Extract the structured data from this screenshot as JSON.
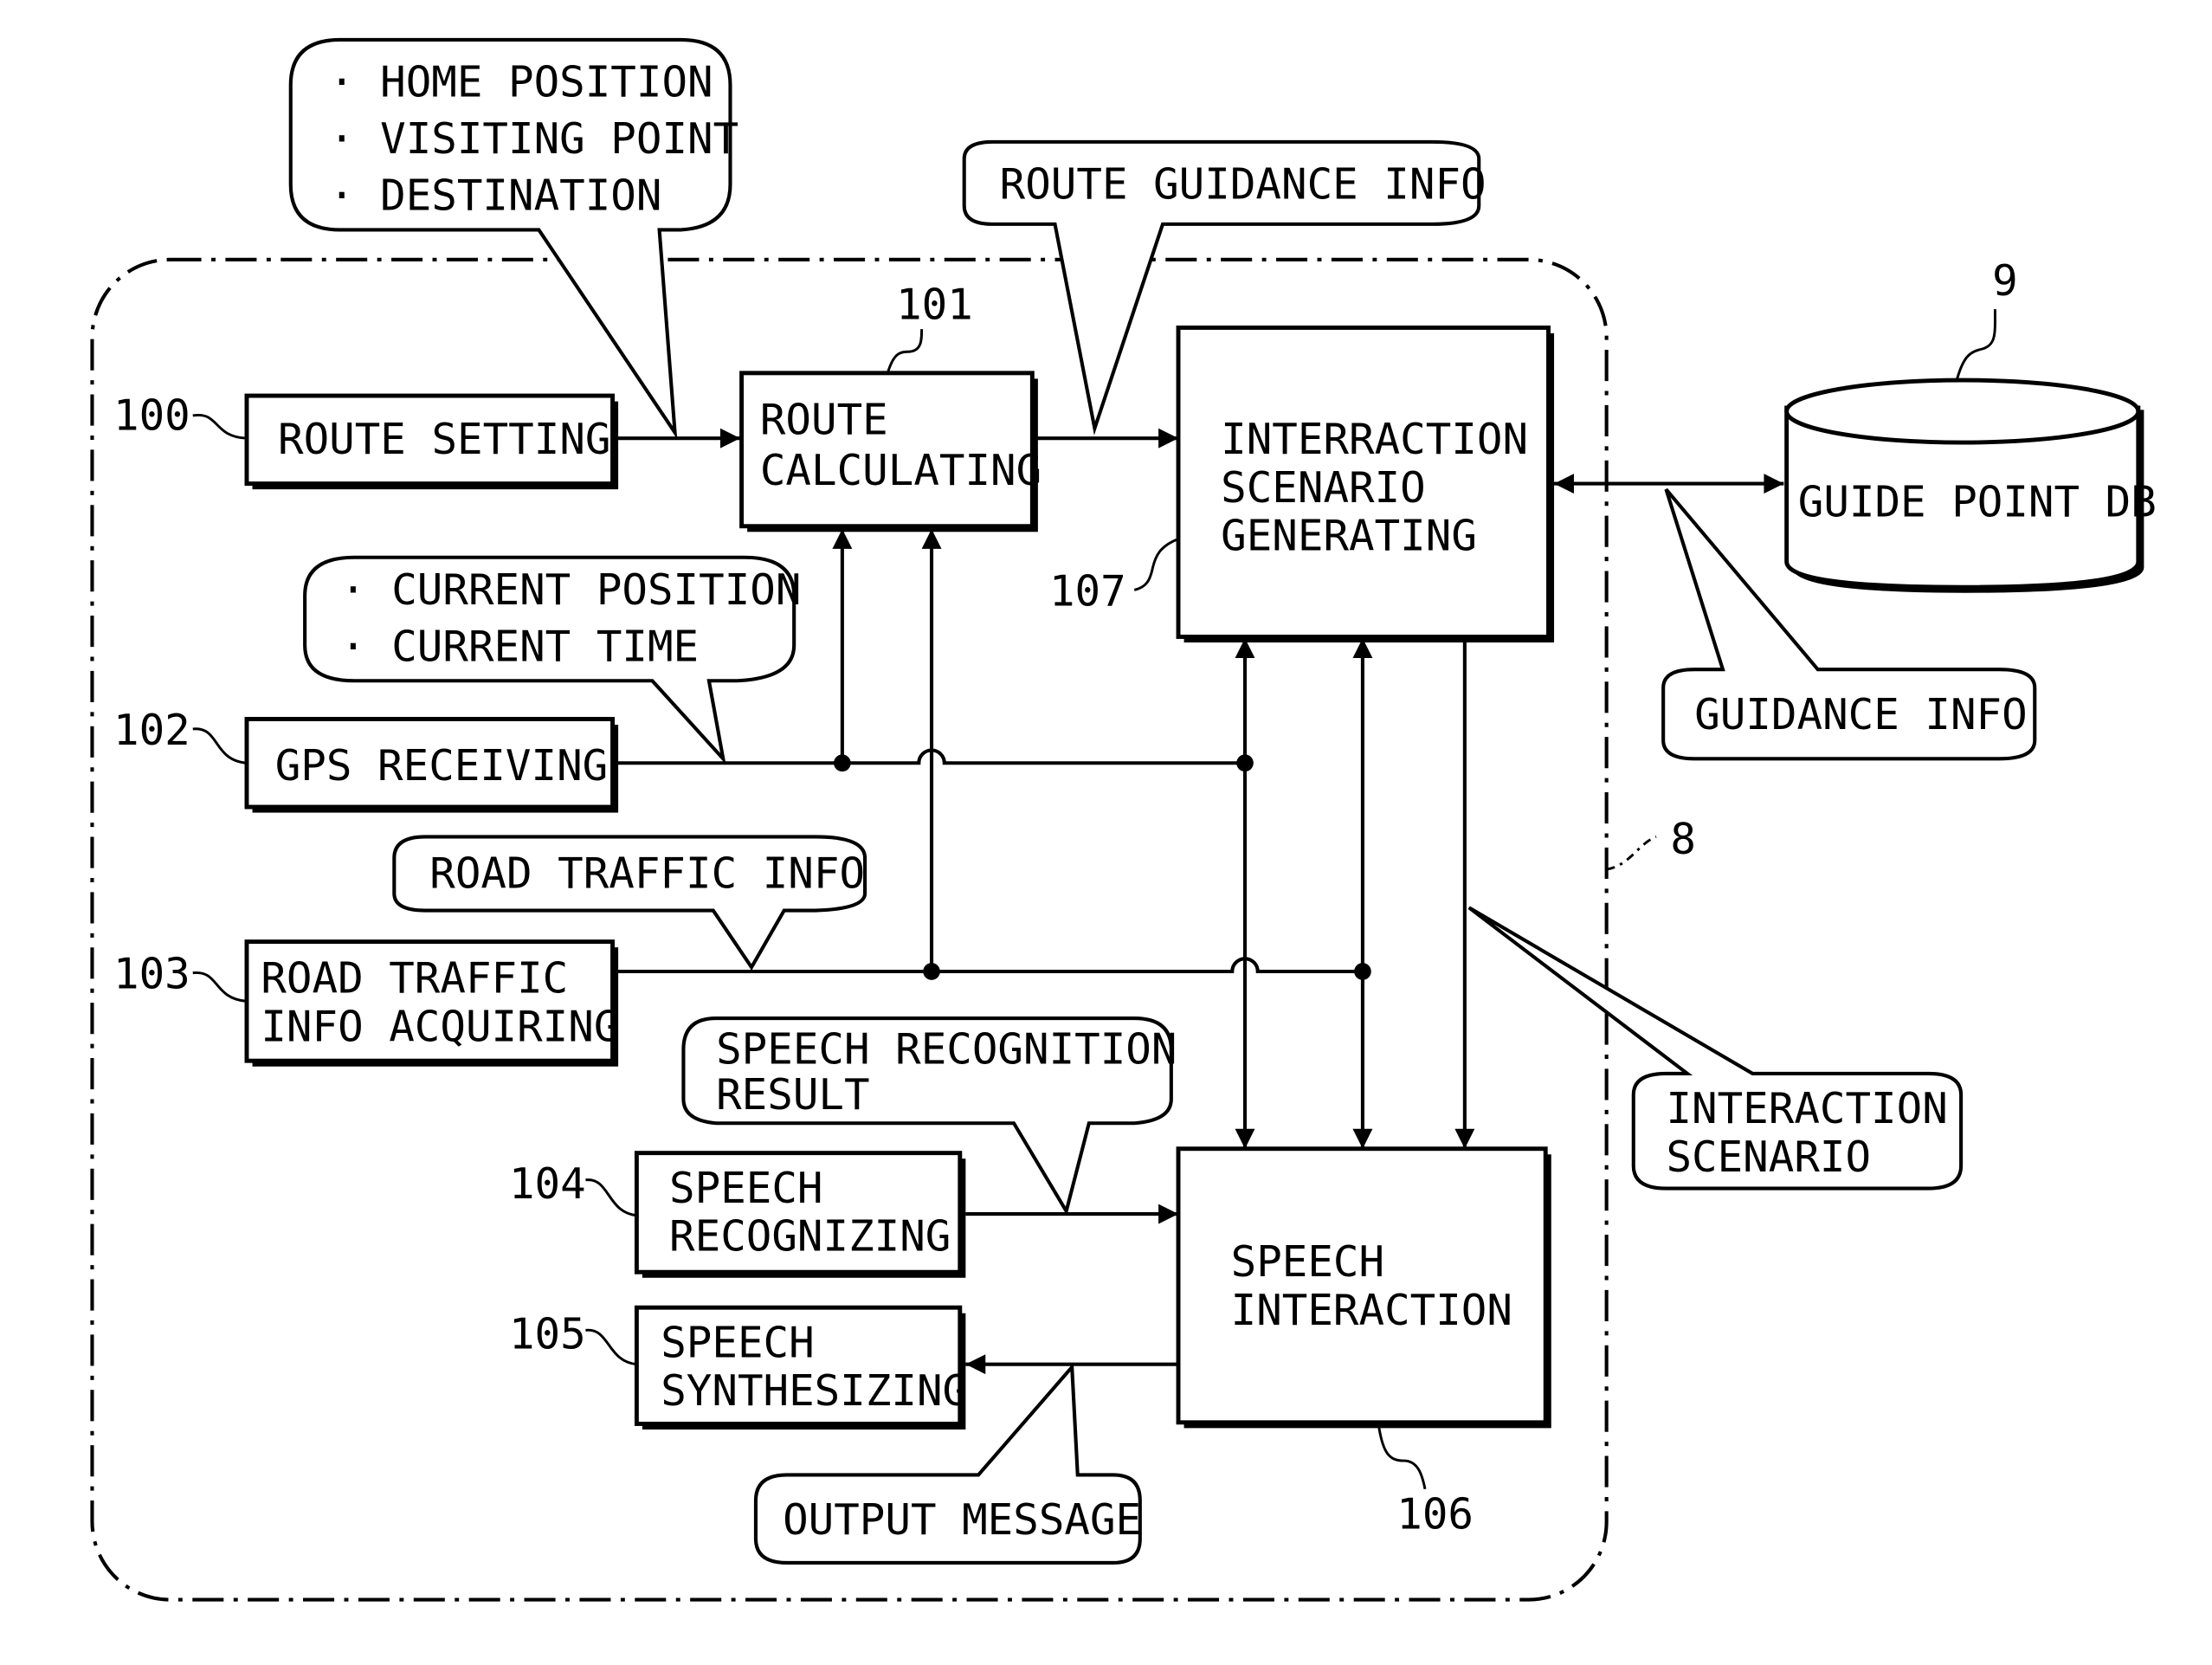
{
  "diagram": {
    "frame": {
      "ref": "8"
    },
    "blocks": {
      "route_setting": {
        "ref": "100",
        "lines": [
          "ROUTE SETTING"
        ]
      },
      "route_calculating": {
        "ref": "101",
        "lines": [
          "ROUTE",
          "CALCULATING"
        ]
      },
      "gps_receiving": {
        "ref": "102",
        "lines": [
          "GPS RECEIVING"
        ]
      },
      "road_traffic": {
        "ref": "103",
        "lines": [
          "ROAD TRAFFIC",
          "INFO ACQUIRING"
        ]
      },
      "speech_recognizing": {
        "ref": "104",
        "lines": [
          "SPEECH",
          "RECOGNIZING"
        ]
      },
      "speech_synthesizing": {
        "ref": "105",
        "lines": [
          "SPEECH",
          "SYNTHESIZING"
        ]
      },
      "speech_interaction": {
        "ref": "106",
        "lines": [
          "SPEECH",
          "INTERACTION"
        ]
      },
      "scenario_generating": {
        "ref": "107",
        "lines": [
          "INTERRACTION",
          "SCENARIO",
          "GENERATING"
        ]
      },
      "guide_point_db": {
        "ref": "9",
        "lines": [
          "GUIDE POINT DB"
        ]
      }
    },
    "callouts": {
      "route_inputs": [
        "· HOME POSITION",
        "· VISITING POINT",
        "· DESTINATION"
      ],
      "route_guidance": [
        "ROUTE GUIDANCE INFO"
      ],
      "gps_info": [
        "· CURRENT POSITION",
        "· CURRENT TIME"
      ],
      "road_traffic_info": [
        "ROAD TRAFFIC INFO"
      ],
      "speech_result": [
        "SPEECH RECOGNITION",
        "RESULT"
      ],
      "output_message": [
        "OUTPUT MESSAGE"
      ],
      "guidance_info": [
        "GUIDANCE INFO"
      ],
      "interaction_scenario": [
        "INTERACTION",
        "SCENARIO"
      ]
    }
  }
}
